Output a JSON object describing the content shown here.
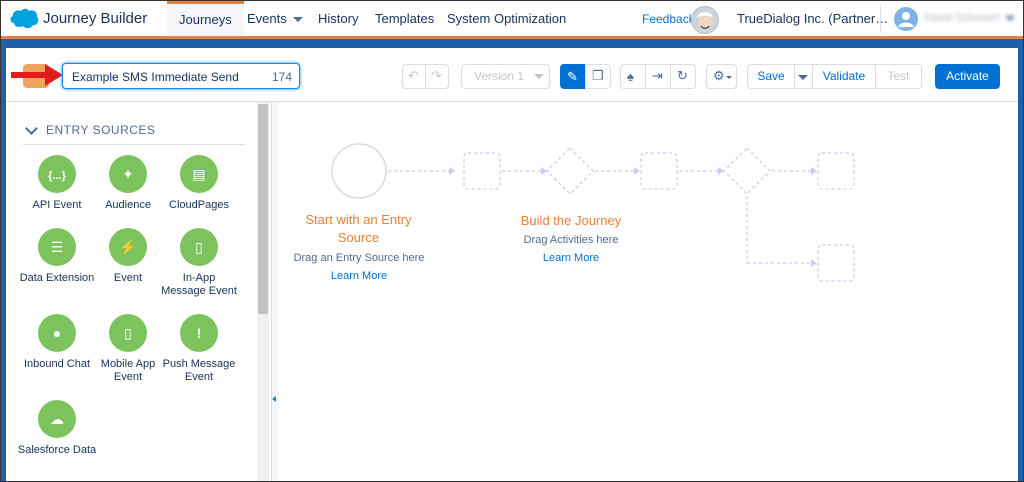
{
  "app": {
    "title": "Journey Builder"
  },
  "nav": {
    "tabs": [
      {
        "label": "Journeys"
      },
      {
        "label": "Events"
      },
      {
        "label": "History"
      },
      {
        "label": "Templates"
      },
      {
        "label": "System Optimization"
      }
    ],
    "feedback": "Feedback",
    "org": "TrueDialog Inc. (Partner…",
    "user": "David Schonert"
  },
  "toolbar": {
    "journey_name": "Example SMS Immediate Send",
    "char_count": "174",
    "version": "Version 1",
    "save": "Save",
    "validate": "Validate",
    "test": "Test",
    "activate": "Activate"
  },
  "sidebar": {
    "section_title": "ENTRY SOURCES",
    "items": [
      {
        "label": "API Event",
        "icon": "api-braces-icon",
        "glyph": "{...}"
      },
      {
        "label": "Audience",
        "icon": "audience-icon",
        "glyph": "✦"
      },
      {
        "label": "CloudPages",
        "icon": "cloudpages-icon",
        "glyph": "▤"
      },
      {
        "label": "Data Extension",
        "icon": "data-extension-icon",
        "glyph": "☰"
      },
      {
        "label": "Event",
        "icon": "lightning-icon",
        "glyph": "⚡"
      },
      {
        "label": "In-App Message Event",
        "icon": "in-app-message-icon",
        "glyph": "▯"
      },
      {
        "label": "Inbound Chat",
        "icon": "chat-icon",
        "glyph": "●"
      },
      {
        "label": "Mobile App Event",
        "icon": "mobile-app-icon",
        "glyph": "▯"
      },
      {
        "label": "Push Message Event",
        "icon": "push-message-icon",
        "glyph": "!"
      },
      {
        "label": "Salesforce Data",
        "icon": "salesforce-cloud-icon",
        "glyph": "☁"
      }
    ]
  },
  "canvas": {
    "entry_title": "Start with an Entry Source",
    "entry_sub": "Drag an Entry Source here",
    "entry_link": "Learn More",
    "build_title": "Build the Journey",
    "build_sub": "Drag Activities here",
    "build_link": "Learn More"
  },
  "colors": {
    "accent_orange": "#e8803a",
    "brand_blue": "#0070d2",
    "entry_green": "#7cc25d",
    "band_blue": "#1d5fa8"
  }
}
